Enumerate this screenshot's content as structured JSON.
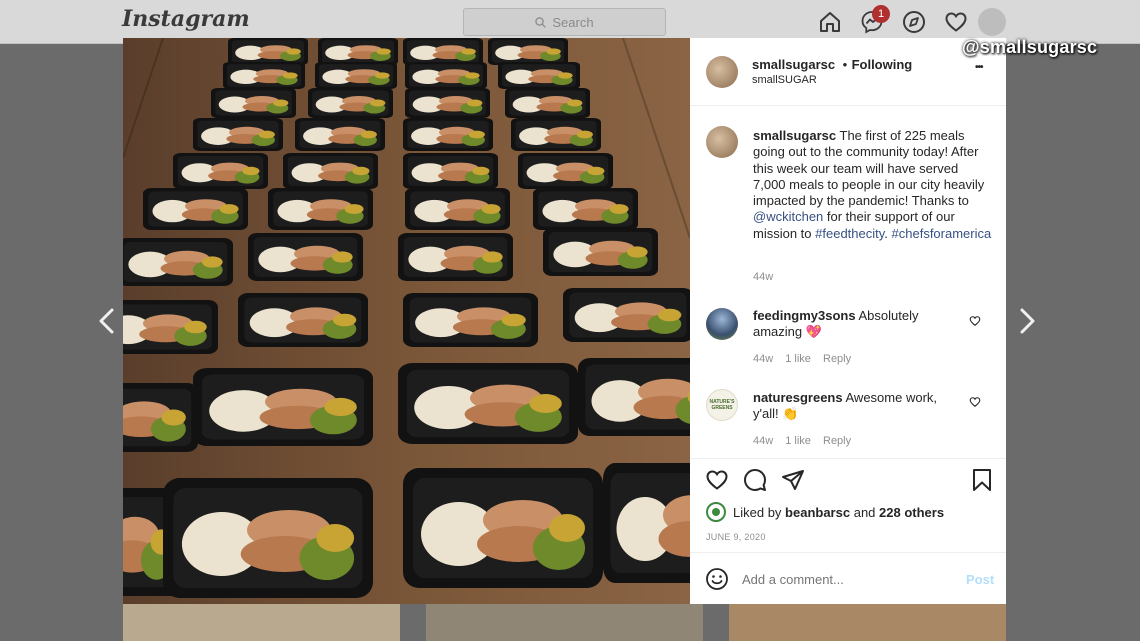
{
  "topbar": {
    "logo": "Instagram",
    "search_placeholder": "Search",
    "notification_count": "1"
  },
  "watermark": "@smallsugarsc",
  "post": {
    "username": "smallsugarsc",
    "following_separator": "•",
    "following_label": "Following",
    "location": "smallSUGAR",
    "more": "•••",
    "caption": {
      "username": "smallsugarsc",
      "text_1": "The first of 225 meals going out to the community today! After this week our team will have served 7,000 meals to people in our city heavily impacted by the pandemic! Thanks to ",
      "mention": "@wckitchen",
      "text_2": " for their support of our mission to ",
      "hashtag_1": "#feedthecity",
      "text_3": ". ",
      "hashtag_2": "#chefsforamerica",
      "time": "44w"
    },
    "comments": [
      {
        "username": "feedingmy3sons",
        "text": "Absolutely amazing",
        "emoji": "💖",
        "time": "44w",
        "likes": "1 like",
        "reply": "Reply"
      },
      {
        "username": "naturesgreens",
        "text": "Awesome work, y'all!",
        "emoji": "👏",
        "time": "44w",
        "likes": "1 like",
        "reply": "Reply",
        "avatar_text": "NATURE'S GREENS"
      }
    ],
    "liked_by_prefix": "Liked by",
    "liked_by_user": "beanbarsc",
    "liked_by_and": "and",
    "liked_by_others": "228 others",
    "date": "JUNE 9, 2020",
    "comment_placeholder": "Add a comment...",
    "post_button": "Post"
  },
  "colors": {
    "link": "#385185",
    "post_button_disabled": "#b2dffc",
    "meta": "#8e8e8e"
  }
}
